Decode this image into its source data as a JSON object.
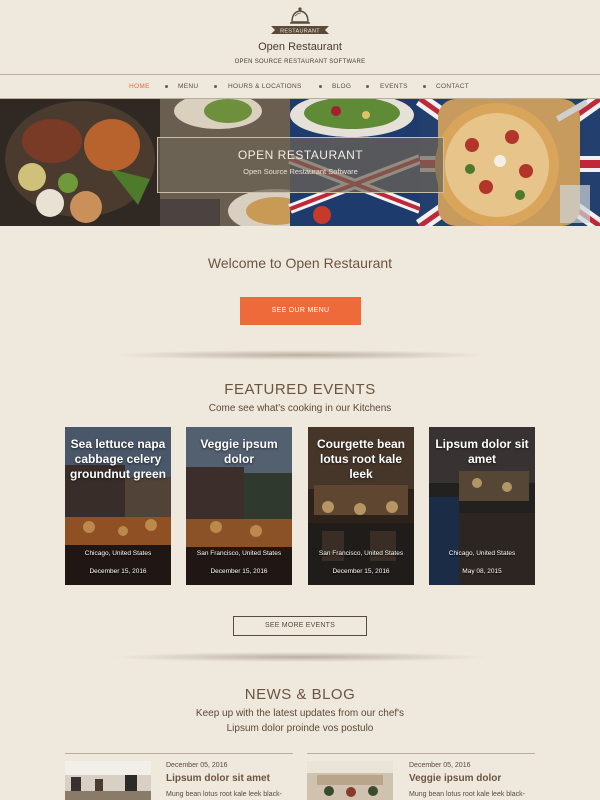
{
  "header": {
    "logo_text": "RESTAURANT",
    "title": "Open Restaurant",
    "tagline": "OPEN SOURCE RESTAURANT SOFTWARE"
  },
  "nav": {
    "items": [
      {
        "label": "HOME",
        "active": true
      },
      {
        "label": "MENU"
      },
      {
        "label": "HOURS & LOCATIONS"
      },
      {
        "label": "BLOG"
      },
      {
        "label": "EVENTS"
      },
      {
        "label": "CONTACT"
      }
    ]
  },
  "hero": {
    "title": "OPEN RESTAURANT",
    "subtitle": "Open Source Restaurant Software"
  },
  "welcome": {
    "heading": "Welcome to Open Restaurant",
    "button_label": "SEE OUR MENU"
  },
  "events": {
    "heading": "FEATURED EVENTS",
    "subheading": "Come see what's cooking in our Kitchens",
    "items": [
      {
        "title": "Sea lettuce napa cabbage celery groundnut green",
        "location": "Chicago, United States",
        "date": "December 15, 2016"
      },
      {
        "title": "Veggie ipsum dolor",
        "location": "San Francisco, United States",
        "date": "December 15, 2016"
      },
      {
        "title": "Courgette bean lotus root kale leek",
        "location": "San Francisco, United States",
        "date": "December 15, 2016"
      },
      {
        "title": "Lipsum dolor sit amet",
        "location": "Chicago, United States",
        "date": "May 08, 2015"
      }
    ],
    "more_label": "SEE MORE EVENTS"
  },
  "blog": {
    "heading": "NEWS & BLOG",
    "subheading_line1": "Keep up with the latest updates from our chef's",
    "subheading_line2": "Lipsum dolor proinde vos postulo",
    "posts": [
      {
        "date": "December 05, 2016",
        "title": "Lipsum dolor sit amet",
        "excerpt": "Mung bean lotus root kale leek black-"
      },
      {
        "date": "December 05, 2016",
        "title": "Veggie ipsum dolor",
        "excerpt": "Mung bean lotus root kale leek black-"
      }
    ]
  },
  "colors": {
    "background": "#efe8dd",
    "accent": "#ef6a3a",
    "text": "#5a4a3a",
    "heading": "#6b5540"
  },
  "icons": {
    "logo": "cloche-icon"
  }
}
